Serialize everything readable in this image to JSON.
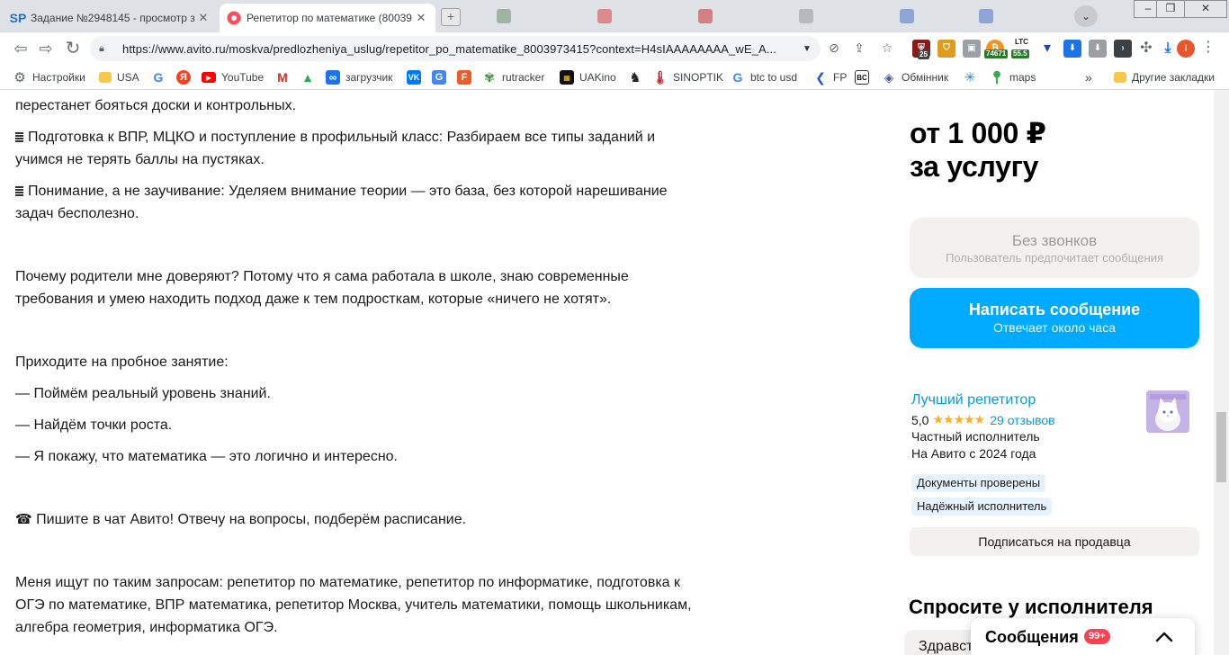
{
  "tabs": [
    {
      "favicon": "SP",
      "title": "Задание №2948145 - просмотр з",
      "active": false
    },
    {
      "favicon": "avito-icon",
      "title": "Репетитор по математике (80039",
      "active": true
    }
  ],
  "toolbar": {
    "url": "https://www.avito.ru/moskva/predlozheniya_uslug/repetitor_po_matematike_8003973415?context=H4sIAAAAAAAA_wE_A...",
    "ext_badges": {
      "ext1": "25",
      "ltc_label": "LTC",
      "btc_value": "74671",
      "ltc_value": "55.5"
    },
    "profile_initial": "I"
  },
  "bookmarks": [
    {
      "label": "Настройки",
      "icon": "gear-icon"
    },
    {
      "label": "USA",
      "icon": "folder-icon"
    },
    {
      "label": "",
      "icon": "google-icon"
    },
    {
      "label": "",
      "icon": "yandex-icon"
    },
    {
      "label": "YouTube",
      "icon": "youtube-icon"
    },
    {
      "label": "",
      "icon": "gmail-icon"
    },
    {
      "label": "",
      "icon": "drive-icon"
    },
    {
      "label": "загрузчик",
      "icon": "infinity-icon"
    },
    {
      "label": "",
      "icon": "vk-icon"
    },
    {
      "label": "",
      "icon": "translate-icon"
    },
    {
      "label": "",
      "icon": "f-icon"
    },
    {
      "label": "rutracker",
      "icon": "rutracker-icon"
    },
    {
      "label": "UAKino",
      "icon": "uakino-icon"
    },
    {
      "label": "",
      "icon": "chess-icon"
    },
    {
      "label": "SINOPTIK",
      "icon": "thermometer-icon"
    },
    {
      "label": "btc to usd",
      "icon": "google-icon"
    },
    {
      "label": "FP",
      "icon": "fp-icon"
    },
    {
      "label": "",
      "icon": "bc-icon"
    },
    {
      "label": "Обмінник",
      "icon": "exchange-icon"
    },
    {
      "label": "",
      "icon": "snowflake-icon"
    },
    {
      "label": "maps",
      "icon": "maps-icon"
    },
    {
      "label": "»",
      "icon": ""
    },
    {
      "label": "Другие закладки",
      "icon": "folder-icon"
    }
  ],
  "description": {
    "p0": "перестанет бояться доски и контрольных.",
    "p1a": "Подготовка к ВПР, МЦКО и поступление в профильный класс: Разбираем все типы заданий и",
    "p1b": "учимся не терять баллы на пустяках.",
    "p2a": "Понимание, а не заучивание: Уделяем внимание теории — это база, без которой нарешивание",
    "p2b": "задач бесполезно.",
    "p3a": "Почему родители мне доверяют? Потому что я сама работала в школе, знаю современные",
    "p3b": "требования и умею находить подход даже к тем подросткам, которые «ничего не хотят».",
    "p4": "Приходите на пробное занятие:",
    "p5": "— Поймём реальный уровень знаний.",
    "p6": "— Найдём точки роста.",
    "p7": "— Я покажу, что математика — это логично и интересно.",
    "p8_icon": "☎",
    "p8": "Пишите в чат Авито! Отвечу на вопросы, подберём расписание.",
    "p9a": "Меня ищут по таким запросам: репетитор по математике, репетитор по информатике, подготовка к",
    "p9b": "ОГЭ по математике, ВПР математика, репетитор Москва, учитель математики, помощь школьникам,",
    "p9c": "алгебра геометрия, информатика ОГЭ."
  },
  "sidebar": {
    "price_line1": "от 1 000 ₽",
    "price_line2": "за услугу",
    "no_calls_title": "Без звонков",
    "no_calls_sub": "Пользователь предпочитает сообщения",
    "write_title": "Написать сообщение",
    "write_sub": "Отвечает около часа",
    "seller_name": "Лучший репетитор",
    "rating": "5,0",
    "stars": "★★★★★",
    "reviews": "29 отзывов",
    "seller_type": "Частный исполнитель",
    "since": "На Авито с 2024 года",
    "badge1": "Документы проверены",
    "badge2": "Надёжный исполнитель",
    "subscribe": "Подписаться на продавца",
    "ask_title": "Спросите у исполнителя",
    "ask_input": "Здравст"
  },
  "messages": {
    "title": "Сообщения",
    "count": "99+"
  },
  "colors": {
    "accent_blue": "#00aaff",
    "link_blue": "#0a9ad8",
    "star": "#ffb021",
    "badge_red": "#ff4053"
  }
}
